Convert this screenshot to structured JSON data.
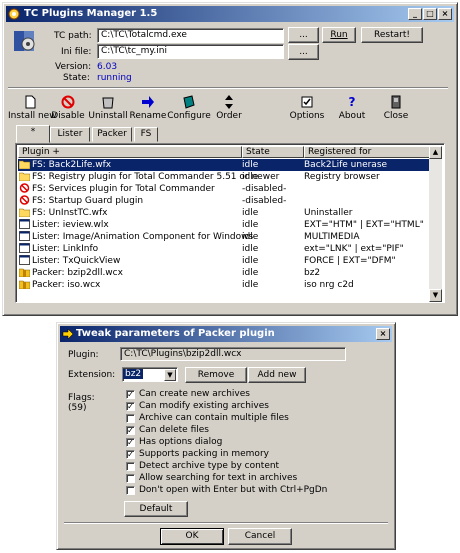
{
  "main": {
    "title": "TC Plugins Manager 1.5",
    "info": {
      "tcpath_label": "TC path:",
      "tcpath": "C:\\TC\\Totalcmd.exe",
      "ini_label": "Ini file:",
      "ini": "C:\\TC\\tc_my.ini",
      "version_label": "Version:",
      "version": "6.03",
      "state_label": "State:",
      "state": "running"
    },
    "buttons": {
      "browse": "...",
      "run": "Run",
      "restart": "Restart!"
    },
    "toolbar": [
      "Install new",
      "Disable",
      "Uninstall",
      "Rename",
      "Configure",
      "Order",
      "Options",
      "About",
      "Close"
    ],
    "tabs": [
      "*",
      "Lister",
      "Packer",
      "FS"
    ],
    "columns": [
      "Plugin +",
      "State",
      "Registered for"
    ],
    "rows": [
      {
        "name": "FS:  Back2Life.wfx",
        "state": "idle",
        "reg": "Back2Life unerase",
        "icon": "folder"
      },
      {
        "name": "FS:  Registry plugin for Total Commander 5.51 or newer",
        "state": "idle",
        "reg": "Registry browser",
        "icon": "folder"
      },
      {
        "name": "FS:  Services plugin for Total Commander",
        "state": "-disabled-",
        "reg": "",
        "icon": "disabled"
      },
      {
        "name": "FS:  Startup Guard plugin",
        "state": "-disabled-",
        "reg": "",
        "icon": "disabled"
      },
      {
        "name": "FS:  UnInstTC.wfx",
        "state": "idle",
        "reg": "Uninstaller",
        "icon": "folder"
      },
      {
        "name": "Lister:  ieview.wlx",
        "state": "idle",
        "reg": "EXT=\"HTM\" | EXT=\"HTML\"",
        "icon": "window"
      },
      {
        "name": "Lister:  Image/Animation Component for Windows",
        "state": "idle",
        "reg": "MULTIMEDIA",
        "icon": "window"
      },
      {
        "name": "Lister:  LinkInfo",
        "state": "idle",
        "reg": "ext=\"LNK\" | ext=\"PIF\"",
        "icon": "window"
      },
      {
        "name": "Lister:  TxQuickView",
        "state": "idle",
        "reg": "FORCE | EXT=\"DFM\"",
        "icon": "window"
      },
      {
        "name": "Packer:  bzip2dll.wcx",
        "state": "idle",
        "reg": "bz2",
        "icon": "packer"
      },
      {
        "name": "Packer:  iso.wcx",
        "state": "idle",
        "reg": "iso nrg c2d",
        "icon": "packer"
      }
    ]
  },
  "dialog": {
    "title": "Tweak parameters of Packer plugin",
    "close": "×",
    "plugin_label": "Plugin:",
    "plugin": "C:\\TC\\Plugins\\bzip2dll.wcx",
    "ext_label": "Extension:",
    "ext": "bz2",
    "remove": "Remove",
    "add": "Add new",
    "flags_label": "Flags:",
    "flags_value": "(59)",
    "flags": [
      {
        "label": "Can create new archives",
        "checked": true
      },
      {
        "label": "Can modify existing archives",
        "checked": true
      },
      {
        "label": "Archive can contain multiple files",
        "checked": false
      },
      {
        "label": "Can delete files",
        "checked": true
      },
      {
        "label": "Has options dialog",
        "checked": true
      },
      {
        "label": "Supports packing in memory",
        "checked": true
      },
      {
        "label": "Detect archive type by content",
        "checked": false
      },
      {
        "label": "Allow searching for text in archives",
        "checked": false
      },
      {
        "label": "Don't open with Enter but with Ctrl+PgDn",
        "checked": false
      }
    ],
    "default": "Default",
    "ok": "OK",
    "cancel": "Cancel"
  },
  "colors": {
    "title": "#0a246a",
    "selection": "#0a246a",
    "state": "#0000c0"
  }
}
